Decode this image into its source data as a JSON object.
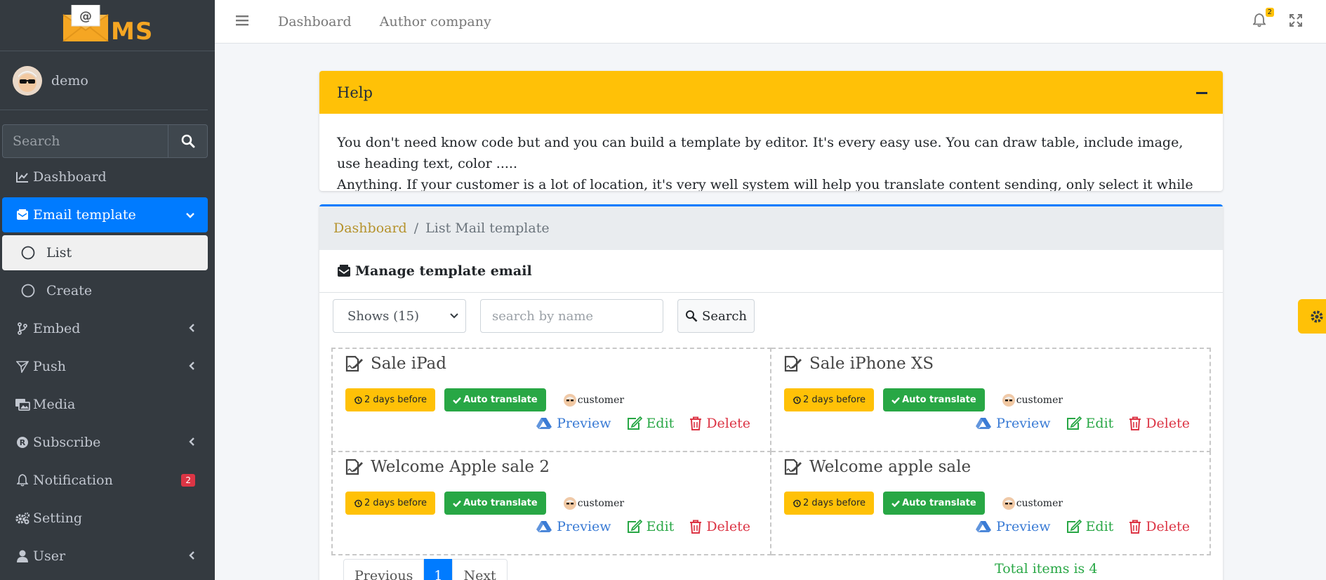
{
  "sidebar": {
    "brand_text": "MS",
    "user_name": "demo",
    "search_placeholder": "Search",
    "items": [
      {
        "label": "Dashboard"
      },
      {
        "label": "Email template"
      },
      {
        "label": "List"
      },
      {
        "label": "Create"
      },
      {
        "label": "Embed"
      },
      {
        "label": "Push"
      },
      {
        "label": "Media"
      },
      {
        "label": "Subscribe"
      },
      {
        "label": "Notification",
        "badge": "2"
      },
      {
        "label": "Setting"
      },
      {
        "label": "User"
      }
    ]
  },
  "topbar": {
    "links": [
      "Dashboard",
      "Author company"
    ],
    "bell_count": "2"
  },
  "help": {
    "title": "Help",
    "line1": "You don't need know code but and you can build a template by editor. It's every easy use. You can draw table, include image, use heading text, color .....",
    "line2": "Anything. If your customer is a lot of location, it's very well system will help you translate content sending, only select it while create and update."
  },
  "main": {
    "breadcrumb": {
      "home": "Dashboard",
      "current": "List Mail template"
    },
    "card_title": "Manage template email",
    "shows_select": "Shows (15)",
    "name_placeholder": "search by name",
    "search_button": "Search",
    "templates": [
      {
        "title": "Sale iPad",
        "time": "2 days before",
        "translate": "Auto translate",
        "owner": "customer",
        "preview": "Preview",
        "edit": "Edit",
        "delete": "Delete"
      },
      {
        "title": "Sale iPhone XS",
        "time": "2 days before",
        "translate": "Auto translate",
        "owner": "customer",
        "preview": "Preview",
        "edit": "Edit",
        "delete": "Delete"
      },
      {
        "title": "Welcome Apple sale 2",
        "time": "2 days before",
        "translate": "Auto translate",
        "owner": "customer",
        "preview": "Preview",
        "edit": "Edit",
        "delete": "Delete"
      },
      {
        "title": "Welcome apple sale",
        "time": "2 days before",
        "translate": "Auto translate",
        "owner": "customer",
        "preview": "Preview",
        "edit": "Edit",
        "delete": "Delete"
      }
    ],
    "pagination": {
      "previous": "Previous",
      "current": "1",
      "next": "Next"
    },
    "total": "Total items is 4"
  },
  "colors": {
    "primary": "#007bff",
    "warning": "#ffc107",
    "success": "#28a745",
    "danger": "#dc3545",
    "sidebar": "#343a40"
  }
}
